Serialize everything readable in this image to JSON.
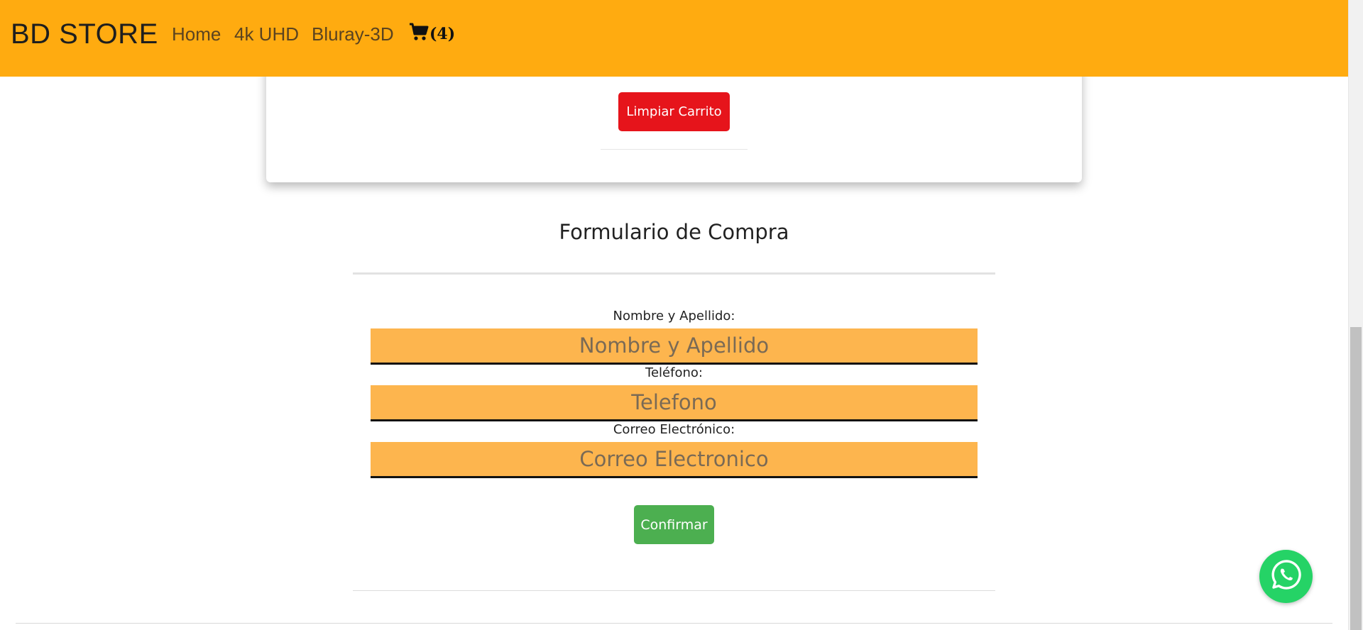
{
  "navbar": {
    "brand": "BD STORE",
    "links": [
      "Home",
      "4k UHD",
      "Bluray-3D"
    ],
    "cart_count": "(4)",
    "background_color": "#ffab10"
  },
  "cart": {
    "clear_button": "Limpiar Carrito",
    "clear_button_color": "#e6141b"
  },
  "form": {
    "title": "Formulario de Compra",
    "fields": [
      {
        "label": "Nombre y Apellido:",
        "placeholder": "Nombre y Apellido"
      },
      {
        "label": "Teléfono:",
        "placeholder": "Telefono"
      },
      {
        "label": "Correo Electrónico:",
        "placeholder": "Correo Electronico"
      }
    ],
    "input_color": "#fdb54e",
    "confirm_button": "Confirmar",
    "confirm_button_color": "#4caf50"
  },
  "whatsapp": {
    "icon": "whatsapp-icon",
    "color": "#25d366"
  }
}
